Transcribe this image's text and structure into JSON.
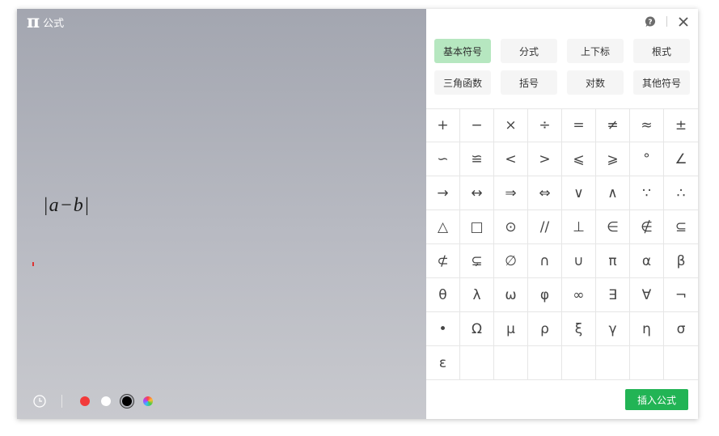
{
  "app": {
    "logo_glyph": "π",
    "title": "公式"
  },
  "editor": {
    "formula": "|a−b|"
  },
  "toolbar": {
    "colors": [
      {
        "name": "red",
        "hex": "#f23a3a"
      },
      {
        "name": "white",
        "hex": "#ffffff"
      },
      {
        "name": "black",
        "hex": "#000000",
        "selected": true
      },
      {
        "name": "custom-color",
        "hex": "rainbow"
      }
    ]
  },
  "tabs": [
    {
      "label": "基本符号",
      "active": true
    },
    {
      "label": "分式"
    },
    {
      "label": "上下标"
    },
    {
      "label": "根式"
    },
    {
      "label": "三角函数"
    },
    {
      "label": "括号"
    },
    {
      "label": "对数"
    },
    {
      "label": "其他符号"
    }
  ],
  "symbols": [
    "+",
    "−",
    "×",
    "÷",
    "=",
    "≠",
    "≈",
    "±",
    "∽",
    "≌",
    "<",
    ">",
    "⩽",
    "⩾",
    "°",
    "∠",
    "→",
    "↔",
    "⇒",
    "⇔",
    "∨",
    "∧",
    "∵",
    "∴",
    "△",
    "□",
    "⊙",
    "//",
    "⊥",
    "∈",
    "∉",
    "⊆",
    "⊄",
    "⊊",
    "∅",
    "∩",
    "∪",
    "π",
    "α",
    "β",
    "θ",
    "λ",
    "ω",
    "φ",
    "∞",
    "∃",
    "∀",
    "¬",
    "•",
    "Ω",
    "μ",
    "ρ",
    "ξ",
    "γ",
    "η",
    "σ",
    "ε",
    "",
    "",
    "",
    "",
    "",
    "",
    ""
  ],
  "actions": {
    "insert_label": "插入公式"
  },
  "colors": {
    "accent": "#22b455",
    "active_tab": "#b6e7c0"
  }
}
